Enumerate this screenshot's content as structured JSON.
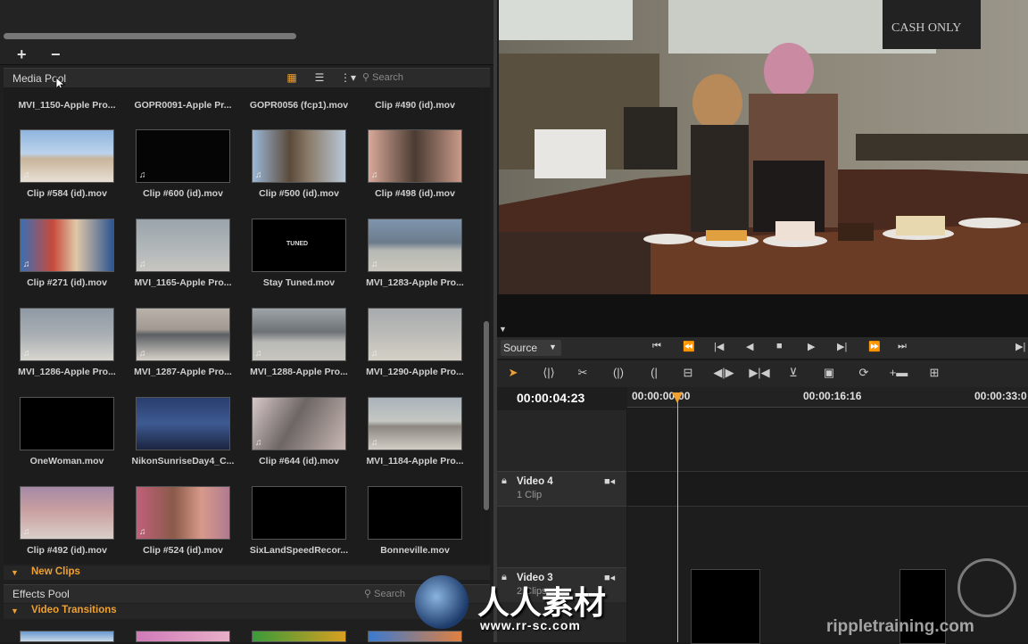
{
  "media_pool": {
    "title": "Media Pool",
    "search_placeholder": "Search",
    "add_label": "+",
    "remove_label": "−",
    "top_row_names": [
      "MVI_1150-Apple Pro...",
      "GOPR0091-Apple Pr...",
      "GOPR0056 (fcp1).mov",
      "Clip #490 (id).mov"
    ],
    "rows": [
      [
        "Clip #584 (id).mov",
        "Clip #600 (id).mov",
        "Clip #500 (id).mov",
        "Clip #498 (id).mov"
      ],
      [
        "Clip #271 (id).mov",
        "MVI_1165-Apple Pro...",
        "Stay Tuned.mov",
        "MVI_1283-Apple Pro..."
      ],
      [
        "MVI_1286-Apple Pro...",
        "MVI_1287-Apple Pro...",
        "MVI_1288-Apple Pro...",
        "MVI_1290-Apple Pro..."
      ],
      [
        "OneWoman.mov",
        "NikonSunriseDay4_C...",
        "Clip #644 (id).mov",
        "MVI_1184-Apple Pro..."
      ],
      [
        "Clip #492 (id).mov",
        "Clip #524 (id).mov",
        "SixLandSpeedRecor...",
        "Bonneville.mov"
      ]
    ],
    "stay_tuned_text": "TUNED",
    "bin_label": "New Clips"
  },
  "effects_pool": {
    "title": "Effects Pool",
    "search_placeholder": "Search",
    "category": "Video Transitions"
  },
  "viewer": {
    "sign_text": "CASH ONLY"
  },
  "transport": {
    "source_label": "Source"
  },
  "timeline": {
    "timecode": "00:00:04:23",
    "ruler": [
      "00:00:00:00",
      "00:00:16:16",
      "00:00:33:0"
    ],
    "tracks": [
      {
        "name": "Video 4",
        "clips": "1 Clip"
      },
      {
        "name": "Video 3",
        "clips": "2 Clips"
      }
    ]
  },
  "watermarks": {
    "cn_text": "人人素材",
    "url": "www.rr-sc.com",
    "brand": "rippletraining.com"
  },
  "colors": {
    "accent": "#f0a030",
    "panel": "#1f1f1f",
    "header": "#2b2b2b"
  }
}
